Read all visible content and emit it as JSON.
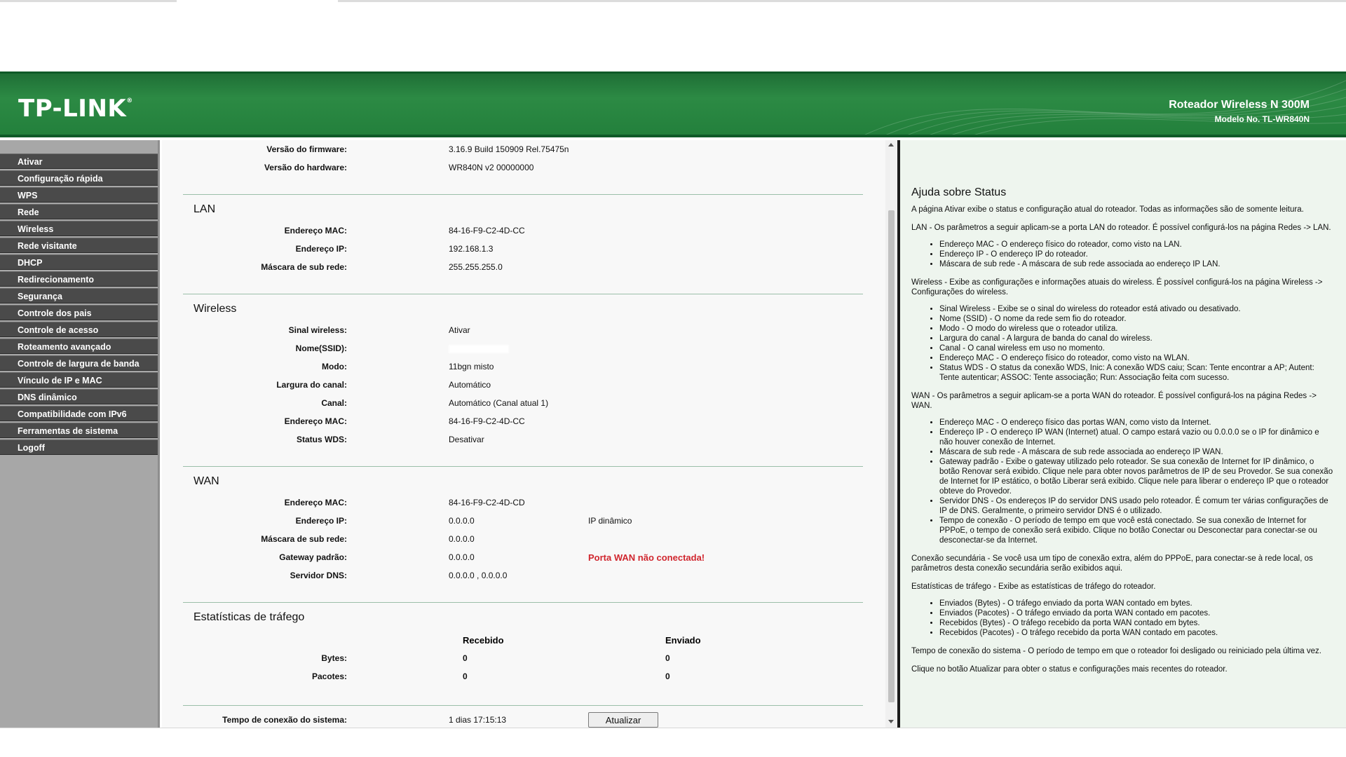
{
  "header": {
    "logo": "TP-LINK",
    "logo_mark": "®",
    "product_title": "Roteador Wireless N 300M",
    "model": "Modelo No. TL-WR840N"
  },
  "sidebar": {
    "items": [
      {
        "label": "Ativar"
      },
      {
        "label": "Configuração rápida"
      },
      {
        "label": "WPS"
      },
      {
        "label": "Rede"
      },
      {
        "label": "Wireless"
      },
      {
        "label": "Rede visitante"
      },
      {
        "label": "DHCP"
      },
      {
        "label": "Redirecionamento"
      },
      {
        "label": "Segurança"
      },
      {
        "label": "Controle dos pais"
      },
      {
        "label": "Controle de acesso"
      },
      {
        "label": "Roteamento avançado"
      },
      {
        "label": "Controle de largura de banda"
      },
      {
        "label": "Vínculo de IP e MAC"
      },
      {
        "label": "DNS dinâmico"
      },
      {
        "label": "Compatibilidade com IPv6"
      },
      {
        "label": "Ferramentas de sistema"
      },
      {
        "label": "Logoff"
      }
    ]
  },
  "status": {
    "firmware_label": "Versão do firmware:",
    "firmware_value": "3.16.9 Build 150909 Rel.75475n",
    "hardware_label": "Versão do hardware:",
    "hardware_value": "WR840N v2 00000000",
    "lan": {
      "title": "LAN",
      "mac_label": "Endereço MAC:",
      "mac_value": "84-16-F9-C2-4D-CC",
      "ip_label": "Endereço IP:",
      "ip_value": "192.168.1.3",
      "mask_label": "Máscara de sub rede:",
      "mask_value": "255.255.255.0"
    },
    "wireless": {
      "title": "Wireless",
      "signal_label": "Sinal wireless:",
      "signal_value": "Ativar",
      "ssid_label": "Nome(SSID):",
      "mode_label": "Modo:",
      "mode_value": "11bgn misto",
      "width_label": "Largura do canal:",
      "width_value": "Automático",
      "channel_label": "Canal:",
      "channel_value": "Automático (Canal atual 1)",
      "mac_label": "Endereço MAC:",
      "mac_value": "84-16-F9-C2-4D-CC",
      "wds_label": "Status WDS:",
      "wds_value": "Desativar"
    },
    "wan": {
      "title": "WAN",
      "mac_label": "Endereço MAC:",
      "mac_value": "84-16-F9-C2-4D-CD",
      "ip_label": "Endereço IP:",
      "ip_value": "0.0.0.0",
      "ip_type": "IP dinâmico",
      "mask_label": "Máscara de sub rede:",
      "mask_value": "0.0.0.0",
      "gateway_label": "Gateway padrão:",
      "gateway_value": "0.0.0.0",
      "gateway_alert": "Porta WAN não conectada!",
      "dns_label": "Servidor DNS:",
      "dns_value": "0.0.0.0 , 0.0.0.0"
    },
    "traffic": {
      "title": "Estatísticas de tráfego",
      "received_header": "Recebido",
      "sent_header": "Enviado",
      "bytes_label": "Bytes:",
      "bytes_received": "0",
      "bytes_sent": "0",
      "packets_label": "Pacotes:",
      "packets_received": "0",
      "packets_sent": "0"
    },
    "uptime_label": "Tempo de conexão do sistema:",
    "uptime_value": "1 dias 17:15:13",
    "refresh_button": "Atualizar"
  },
  "help": {
    "title": "Ajuda sobre Status",
    "intro": "A página Ativar exibe o status e configuração atual do roteador. Todas as informações são de somente leitura.",
    "lan_text": "LAN - Os parâmetros a seguir aplicam-se a porta LAN do roteador. É possível configurá-los na página Redes -> LAN.",
    "lan_items": [
      "Endereço MAC - O endereço físico do roteador, como visto na LAN.",
      "Endereço IP - O endereço IP do roteador.",
      "Máscara de sub rede - A máscara de sub rede associada ao endereço IP LAN."
    ],
    "wireless_text": "Wireless - Exibe as configurações e informações atuais do wireless. É possível configurá-los na página Wireless -> Configurações do wireless.",
    "wireless_items": [
      "Sinal Wireless - Exibe se o sinal do wireless do roteador está ativado ou desativado.",
      "Nome (SSID) - O nome da rede sem fio do roteador.",
      "Modo - O modo do wireless que o roteador utiliza.",
      "Largura do canal - A largura de banda do canal do wireless.",
      "Canal - O canal wireless em uso no momento.",
      "Endereço MAC - O endereço físico do roteador, como visto na WLAN.",
      "Status WDS - O status da conexão WDS, Inic: A conexão WDS caiu; Scan: Tente encontrar a AP; Autent: Tente autenticar; ASSOC: Tente associação; Run: Associação feita com sucesso."
    ],
    "wan_text": "WAN - Os parâmetros a seguir aplicam-se a porta WAN do roteador. É possível configurá-los na página Redes -> WAN.",
    "wan_items": [
      "Endereço MAC - O endereço físico das portas WAN, como visto da Internet.",
      "Endereço IP - O endereço IP WAN (Internet) atual. O campo estará vazio ou 0.0.0.0 se o IP for dinâmico e não houver conexão de Internet.",
      "Máscara de sub rede - A máscara de sub rede associada ao endereço IP WAN.",
      "Gateway padrão - Exibe o gateway utilizado pelo roteador. Se sua conexão de Internet for IP dinâmico, o botão Renovar será exibido. Clique nele para obter novos parâmetros de IP de seu Provedor. Se sua conexão de Internet for IP estático, o botão Liberar será exibido. Clique nele para liberar o endereço IP que o roteador obteve do Provedor.",
      "Servidor DNS - Os endereços IP do servidor DNS usado pelo roteador. É comum ter várias configurações de IP de DNS. Geralmente, o primeiro servidor DNS é o utilizado.",
      "Tempo de conexão - O período de tempo em que você está conectado. Se sua conexão de Internet for PPPoE, o tempo de conexão será exibido. Clique no botão Conectar ou Desconectar para conectar-se ou desconectar-se da Internet."
    ],
    "secondary_text": "Conexão secundária - Se você usa um tipo de conexão extra, além do PPPoE, para conectar-se à rede local, os parâmetros desta conexão secundária serão exibidos aqui.",
    "traffic_text": "Estatísticas de tráfego - Exibe as estatísticas de tráfego do roteador.",
    "traffic_items": [
      "Enviados (Bytes) - O tráfego enviado da porta WAN contado em bytes.",
      "Enviados (Pacotes) - O tráfego enviado da porta WAN contado em pacotes.",
      "Recebidos (Bytes) - O tráfego recebido da porta WAN contado em bytes.",
      "Recebidos (Pacotes) - O tráfego recebido da porta WAN contado em pacotes."
    ],
    "uptime_text": "Tempo de conexão do sistema - O período de tempo em que o roteador foi desligado ou reiniciado pela última vez.",
    "refresh_text": "Clique no botão Atualizar para obter o status e configurações mais recentes do roteador."
  },
  "colors": {
    "header_green": "#2c8a44",
    "alert_red": "#d0262e",
    "menu_bg": "#4a4a4a"
  }
}
